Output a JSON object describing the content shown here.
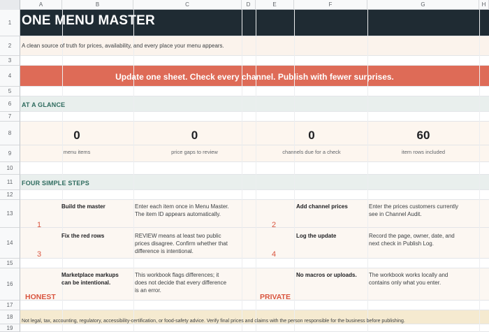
{
  "columns": [
    "A",
    "B",
    "C",
    "D",
    "E",
    "F",
    "G",
    "H"
  ],
  "rows": [
    "1",
    "2",
    "3",
    "4",
    "5",
    "6",
    "7",
    "8",
    "9",
    "10",
    "11",
    "12",
    "13",
    "14",
    "15",
    "16",
    "17",
    "18",
    "19"
  ],
  "title": "ONE MENU MASTER",
  "tagline": "A clean source of truth for prices, availability, and every place your menu appears.",
  "banner": "Update one sheet. Check every channel. Publish with fewer surprises.",
  "at_a_glance": {
    "heading": "AT A GLANCE",
    "kpis": [
      {
        "value": "0",
        "label": "menu items"
      },
      {
        "value": "0",
        "label": "price gaps to review"
      },
      {
        "value": "0",
        "label": "channels due for a check"
      },
      {
        "value": "60",
        "label": "item rows included"
      }
    ]
  },
  "steps_section": {
    "heading": "FOUR SIMPLE STEPS",
    "steps": [
      {
        "number": "1",
        "title": "Build the master",
        "desc_1": "Enter each item once in Menu Master.",
        "desc_2": "The item ID appears automatically.",
        "desc_3": ""
      },
      {
        "number": "2",
        "title": "Add channel prices",
        "desc_1": "Enter the prices customers currently",
        "desc_2": "see in Channel Audit.",
        "desc_3": ""
      },
      {
        "number": "3",
        "title": "Fix the red rows",
        "desc_1": "REVIEW means at least two public",
        "desc_2": "prices disagree. Confirm whether that",
        "desc_3": "difference is intentional."
      },
      {
        "number": "4",
        "title": "Log the update",
        "desc_1": "Record the page, owner, date, and",
        "desc_2": "next check in Publish Log.",
        "desc_3": ""
      }
    ],
    "notes": [
      {
        "badge": "HONEST",
        "title_1": "Marketplace markups",
        "title_2": "can be intentional.",
        "desc_1": "This workbook flags differences; it",
        "desc_2": "does not decide that every difference",
        "desc_3": "is an error."
      },
      {
        "badge": "PRIVATE",
        "title_1": "No macros or uploads.",
        "title_2": "",
        "desc_1": "The workbook works locally and",
        "desc_2": "contains only what you enter.",
        "desc_3": ""
      }
    ]
  },
  "disclaimer": "Not legal, tax, accounting, regulatory, accessibility-certification, or food-safety advice. Verify final prices and claims with the person responsible for the business before publishing.",
  "colors": {
    "title_bg": "#1f2b33",
    "banner_bg": "#de6b57",
    "accent": "#d9553f",
    "section_text": "#2e6b5e",
    "disclaimer_bg": "#f5ead0"
  }
}
